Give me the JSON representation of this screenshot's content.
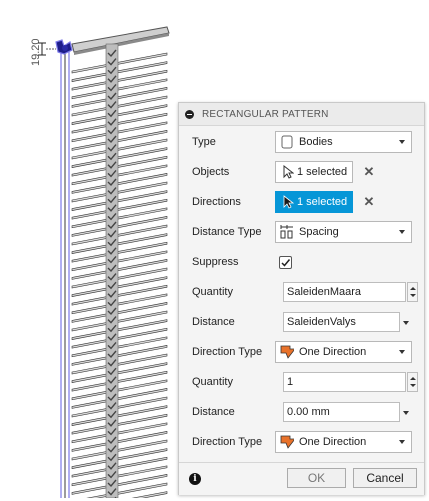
{
  "viewport": {
    "dimension_label": "19.20"
  },
  "panel": {
    "title": "RECTANGULAR PATTERN",
    "rows": {
      "type": {
        "label": "Type",
        "value": "Bodies",
        "icon": "body-icon"
      },
      "objects": {
        "label": "Objects",
        "value": "1 selected",
        "clear": "✕"
      },
      "directions": {
        "label": "Directions",
        "value": "1 selected",
        "clear": "✕"
      },
      "distance_type": {
        "label": "Distance Type",
        "value": "Spacing",
        "icon": "spacing-icon"
      },
      "suppress": {
        "label": "Suppress",
        "checked": true
      },
      "quantity1": {
        "label": "Quantity",
        "value": "SaleidenMaara"
      },
      "distance1": {
        "label": "Distance",
        "value": "SaleidenValys"
      },
      "direction_type1": {
        "label": "Direction Type",
        "value": "One Direction",
        "icon": "direction-icon"
      },
      "quantity2": {
        "label": "Quantity",
        "value": "1"
      },
      "distance2": {
        "label": "Distance",
        "value": "0.00 mm"
      },
      "direction_type2": {
        "label": "Direction Type",
        "value": "One Direction",
        "icon": "direction-icon"
      }
    },
    "footer": {
      "ok_label": "OK",
      "cancel_label": "Cancel"
    }
  },
  "colors": {
    "accent": "#0696d7",
    "arrow_orange": "#e8722a"
  }
}
